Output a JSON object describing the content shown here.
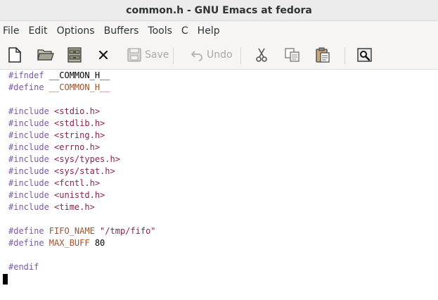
{
  "window": {
    "title": "common.h - GNU Emacs at fedora"
  },
  "menu": [
    "File",
    "Edit",
    "Options",
    "Buffers",
    "Tools",
    "C",
    "Help"
  ],
  "toolbar": {
    "save_label": "Save",
    "undo_label": "Undo",
    "icons": [
      "new-file-icon",
      "open-folder-icon",
      "open-directory-icon",
      "close-icon",
      "save-icon",
      "undo-icon",
      "cut-icon",
      "copy-icon",
      "paste-icon",
      "search-icon"
    ]
  },
  "colors": {
    "preprocessor": "#7b5aa6",
    "string": "#8b2252",
    "variable": "#a0522d",
    "text": "#000000"
  },
  "code": {
    "l1": {
      "kw": "#ifndef",
      "rest": " __COMMON_H__"
    },
    "l2": {
      "kw": "#define",
      "var": " __COMMON_H__"
    },
    "l4": {
      "kw": "#include",
      "str": " <stdio.h>"
    },
    "l5": {
      "kw": "#include",
      "str": " <stdlib.h>"
    },
    "l6": {
      "kw": "#include",
      "str": " <string.h>"
    },
    "l7": {
      "kw": "#include",
      "str": " <errno.h>"
    },
    "l8": {
      "kw": "#include",
      "str": " <sys/types.h>"
    },
    "l9": {
      "kw": "#include",
      "str": " <sys/stat.h>"
    },
    "l10": {
      "kw": "#include",
      "str": " <fcntl.h>"
    },
    "l11": {
      "kw": "#include",
      "str": " <unistd.h>"
    },
    "l12": {
      "kw": "#include",
      "str": " <time.h>"
    },
    "l14": {
      "kw": "#define",
      "var": " FIFO_NAME",
      "str": " \"/tmp/fifo\""
    },
    "l15": {
      "kw": "#define",
      "var": " MAX_BUFF",
      "rest": " 80"
    },
    "l17": {
      "kw": "#endif"
    }
  }
}
